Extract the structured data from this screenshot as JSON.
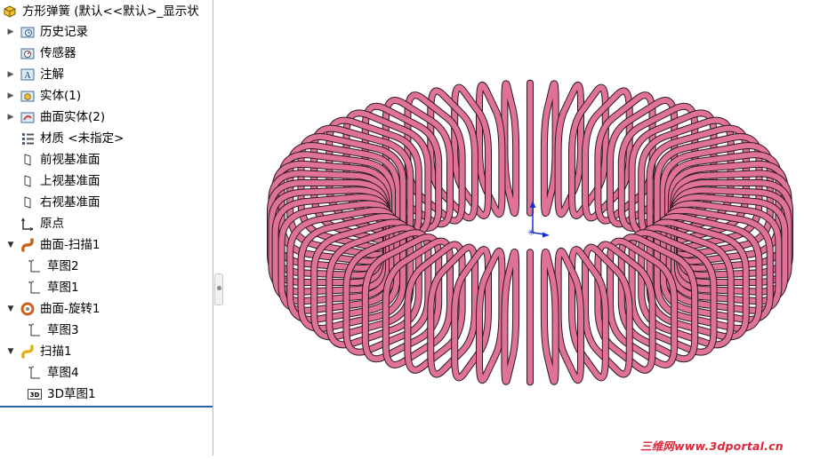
{
  "feature_tree": {
    "root": "方形弹簧 (默认<<默认>_显示状",
    "items": [
      {
        "label": "历史记录",
        "icon": "history-folder-icon"
      },
      {
        "label": "传感器",
        "icon": "sensor-icon"
      },
      {
        "label": "注解",
        "icon": "annotation-icon"
      },
      {
        "label": "实体(1)",
        "icon": "solid-bodies-icon"
      },
      {
        "label": "曲面实体(2)",
        "icon": "surface-bodies-icon"
      },
      {
        "label": "材质 <未指定>",
        "icon": "material-icon"
      },
      {
        "label": "前视基准面",
        "icon": "plane-icon"
      },
      {
        "label": "上视基准面",
        "icon": "plane-icon"
      },
      {
        "label": "右视基准面",
        "icon": "plane-icon"
      },
      {
        "label": "原点",
        "icon": "origin-icon"
      },
      {
        "label": "曲面-扫描1",
        "icon": "surface-sweep-icon"
      },
      {
        "label": "草图2",
        "icon": "sketch-icon"
      },
      {
        "label": "草图1",
        "icon": "sketch-icon"
      },
      {
        "label": "曲面-旋转1",
        "icon": "surface-revolve-icon"
      },
      {
        "label": "草图3",
        "icon": "sketch-icon"
      },
      {
        "label": "扫描1",
        "icon": "sweep-icon"
      },
      {
        "label": "草图4",
        "icon": "sketch-icon"
      },
      {
        "label": "3D草图1",
        "icon": "3d-sketch-icon"
      }
    ]
  },
  "model": {
    "coil_color": "#e0729a",
    "coil_edge_color": "#2a1a22"
  },
  "watermark": "三维网www.3dportal.cn"
}
